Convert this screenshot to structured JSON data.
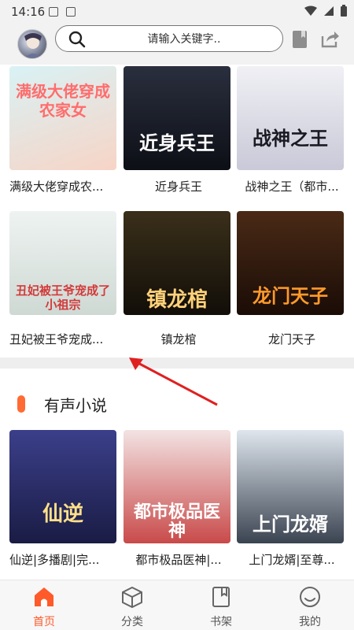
{
  "status_bar": {
    "time": "14:16"
  },
  "search": {
    "placeholder": "请输入关键字.."
  },
  "books": [
    {
      "title": "满级大佬穿成农...",
      "cover_text": "满级大佬穿成农家女",
      "cover_colors": [
        "#d9f2f5",
        "#f7d4c6"
      ]
    },
    {
      "title": "近身兵王",
      "cover_text": "近身兵王",
      "cover_colors": [
        "#2a2f3e",
        "#0d0f16"
      ]
    },
    {
      "title": "战神之王（都市...",
      "cover_text": "战神之王",
      "cover_colors": [
        "#f0f0f5",
        "#c9c9d8"
      ]
    },
    {
      "title": "丑妃被王爷宠成...",
      "cover_text": "丑妃被王爷宠成了小祖宗",
      "cover_colors": [
        "#eef3f1",
        "#cfd9d4"
      ]
    },
    {
      "title": "镇龙棺",
      "cover_text": "镇龙棺",
      "cover_colors": [
        "#3a2f1a",
        "#120e08"
      ]
    },
    {
      "title": "龙门天子",
      "cover_text": "龙门天子",
      "cover_colors": [
        "#4a2a16",
        "#1a0c06"
      ]
    }
  ],
  "audio_section": {
    "title": "有声小说"
  },
  "audio_books": [
    {
      "title": "仙逆|多播剧|完...",
      "cover_text": "仙逆",
      "cover_colors": [
        "#3b3f8a",
        "#1a1c44"
      ]
    },
    {
      "title": "都市极品医神|...",
      "cover_text": "都市极品医神",
      "cover_colors": [
        "#f3e3e3",
        "#c94a4a"
      ]
    },
    {
      "title": "上门龙婿|至尊...",
      "cover_text": "上门龙婿",
      "cover_colors": [
        "#dfe6ee",
        "#3a4350"
      ]
    }
  ],
  "nav": [
    {
      "label": "首页",
      "icon": "home-icon",
      "active": true
    },
    {
      "label": "分类",
      "icon": "category-cube-icon",
      "active": false
    },
    {
      "label": "书架",
      "icon": "bookshelf-icon",
      "active": false
    },
    {
      "label": "我的",
      "icon": "profile-icon",
      "active": false
    }
  ],
  "colors": {
    "accent": "#ff5a2a",
    "section_mark": "#ff6b35",
    "arrow": "#e02020"
  }
}
